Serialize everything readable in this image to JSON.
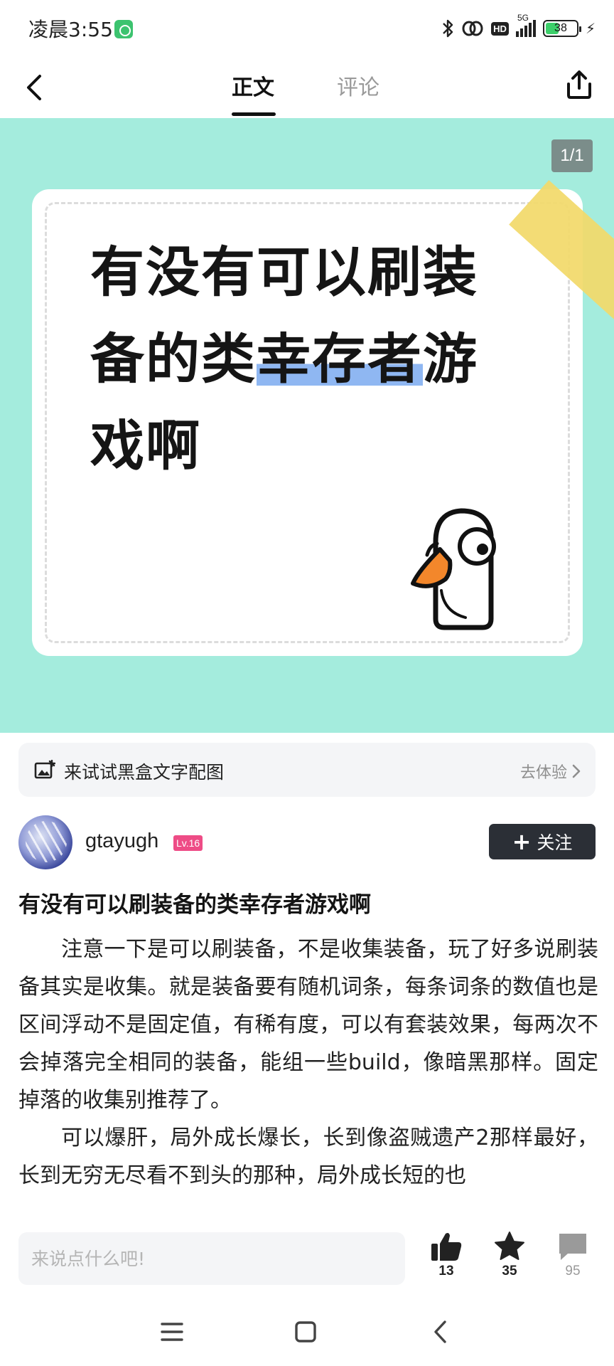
{
  "status_bar": {
    "time": "凌晨3:55",
    "network": "5G",
    "hd": "HD",
    "battery": "38"
  },
  "header": {
    "tabs": [
      {
        "label": "正文",
        "active": true
      },
      {
        "label": "评论",
        "active": false
      }
    ]
  },
  "hero": {
    "page_indicator": "1/1",
    "headline_lines": [
      "有没有可以刷装",
      "备的类",
      "幸存者",
      "游",
      "戏啊"
    ],
    "colors": {
      "background": "#a4ecdd",
      "tape": "#f2d969",
      "highlight": "#8fb7f2"
    }
  },
  "promo": {
    "text": "来试试黑盒文字配图",
    "cta": "去体验"
  },
  "author": {
    "name": "gtayugh",
    "level": "Lv.16",
    "follow_label": "关注"
  },
  "post": {
    "title": "有没有可以刷装备的类幸存者游戏啊",
    "paragraphs": [
      "注意一下是可以刷装备，不是收集装备，玩了好多说刷装备其实是收集。就是装备要有随机词条，每条词条的数值也是区间浮动不是固定值，有稀有度，可以有套装效果，每两次不会掉落完全相同的装备，能组一些build，像暗黑那样。固定掉落的收集别推荐了。",
      "可以爆肝，局外成长爆长，长到像盗贼遗产2那样最好，长到无穷无尽看不到头的那种，局外成长短的也"
    ]
  },
  "bottom_bar": {
    "comment_placeholder": "来说点什么吧!",
    "likes": "13",
    "favorites": "35",
    "comments": "95"
  }
}
